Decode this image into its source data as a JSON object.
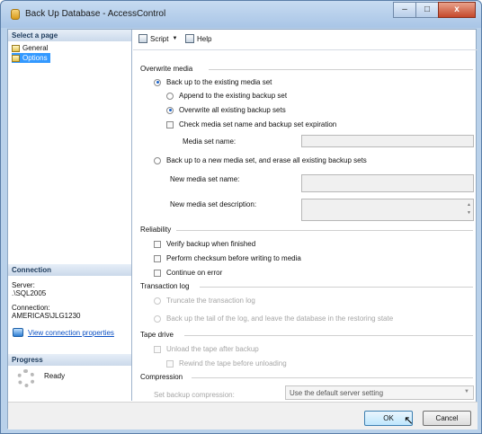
{
  "window": {
    "title": "Back Up Database - AccessControl",
    "minimize": "–",
    "maximize": "□",
    "close": "x"
  },
  "left": {
    "select_page_header": "Select a page",
    "pages": [
      "General",
      "Options"
    ],
    "selected_page": "Options",
    "connection_header": "Connection",
    "server_label": "Server:",
    "server_value": ".\\SQL2005",
    "connection_label": "Connection:",
    "connection_value": "AMERICAS\\JLG1230",
    "view_connection_link": "View connection properties",
    "progress_header": "Progress",
    "progress_status": "Ready"
  },
  "toolbar": {
    "script_label": "Script",
    "help_label": "Help"
  },
  "overwrite_media": {
    "group_label": "Overwrite media",
    "backup_existing": "Back up to the existing media set",
    "append": "Append to the existing backup set",
    "overwrite_all": "Overwrite all existing backup sets",
    "check_name_expiration": "Check media set name and backup set expiration",
    "media_set_name_label": "Media set name:",
    "media_set_name_value": "",
    "backup_new": "Back up to a new media set, and erase all existing backup sets",
    "new_media_set_name_label": "New media set name:",
    "new_media_set_name_value": "",
    "new_media_set_desc_label": "New media set description:",
    "new_media_set_desc_value": ""
  },
  "reliability": {
    "group_label": "Reliability",
    "verify": "Verify backup when finished",
    "checksum": "Perform checksum before writing to media",
    "continue_on_error": "Continue on error"
  },
  "transaction_log": {
    "group_label": "Transaction log",
    "truncate": "Truncate the transaction log",
    "tail": "Back up the tail of the log, and leave the database in the restoring state"
  },
  "tape_drive": {
    "group_label": "Tape drive",
    "unload": "Unload the tape after backup",
    "rewind": "Rewind the tape before unloading"
  },
  "compression": {
    "group_label": "Compression",
    "set_label": "Set backup compression:",
    "selected_value": "Use the default server setting"
  },
  "buttons": {
    "ok": "OK",
    "cancel": "Cancel"
  }
}
